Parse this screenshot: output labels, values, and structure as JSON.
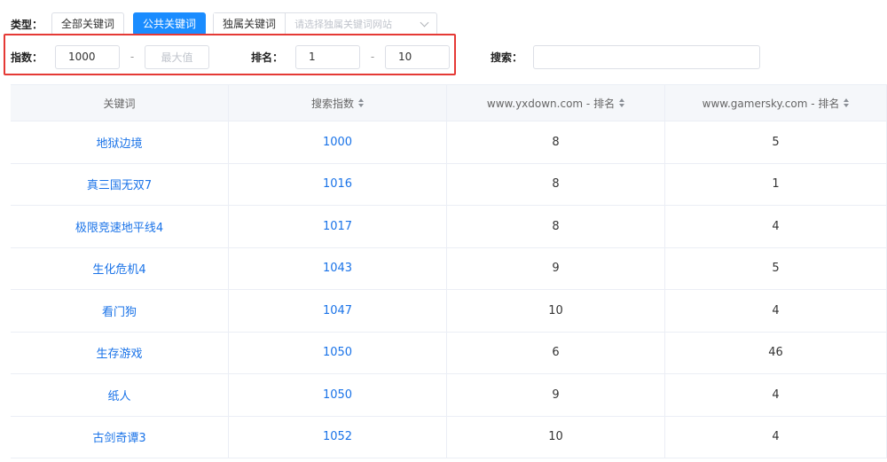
{
  "filters": {
    "type_label": "类型：",
    "type_all": "全部关键词",
    "type_public": "公共关键词",
    "type_exclusive": "独属关键词",
    "site_placeholder": "请选择独属关键词网站",
    "index_label": "指数：",
    "index_min": "1000",
    "index_max_placeholder": "最大值",
    "rank_label": "排名：",
    "rank_min": "1",
    "rank_max": "10",
    "dash": "-",
    "search_label": "搜索："
  },
  "table": {
    "headers": [
      "关键词",
      "搜索指数",
      "www.yxdown.com - 排名",
      "www.gamersky.com - 排名"
    ],
    "rows": [
      [
        "地狱边境",
        "1000",
        "8",
        "5"
      ],
      [
        "真三国无双7",
        "1016",
        "8",
        "1"
      ],
      [
        "极限竞速地平线4",
        "1017",
        "8",
        "4"
      ],
      [
        "生化危机4",
        "1043",
        "9",
        "5"
      ],
      [
        "看门狗",
        "1047",
        "10",
        "4"
      ],
      [
        "生存游戏",
        "1050",
        "6",
        "46"
      ],
      [
        "纸人",
        "1050",
        "9",
        "4"
      ],
      [
        "古剑奇谭3",
        "1052",
        "10",
        "4"
      ]
    ]
  },
  "colors": {
    "accent": "#1a8cff",
    "link": "#1a73e8",
    "highlight": "#e53935"
  }
}
